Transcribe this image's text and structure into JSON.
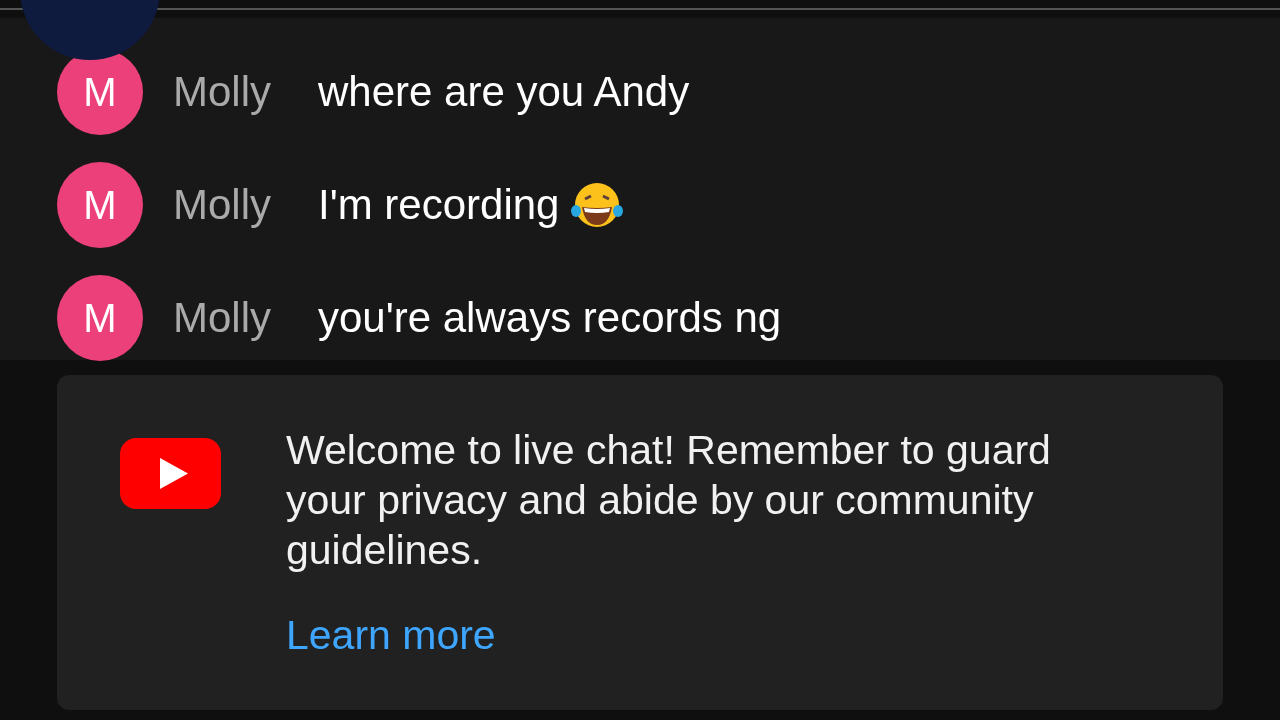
{
  "messages": [
    {
      "initial": "M",
      "author": "Molly",
      "text": "where are you Andy",
      "emoji": false
    },
    {
      "initial": "M",
      "author": "Molly",
      "text": "I'm recording",
      "emoji": true
    },
    {
      "initial": "M",
      "author": "Molly",
      "text": "you're always records ng",
      "emoji": false
    }
  ],
  "welcome": {
    "text": "Welcome to live chat! Remember to guard your privacy and abide by our community guidelines.",
    "link": "Learn more"
  }
}
